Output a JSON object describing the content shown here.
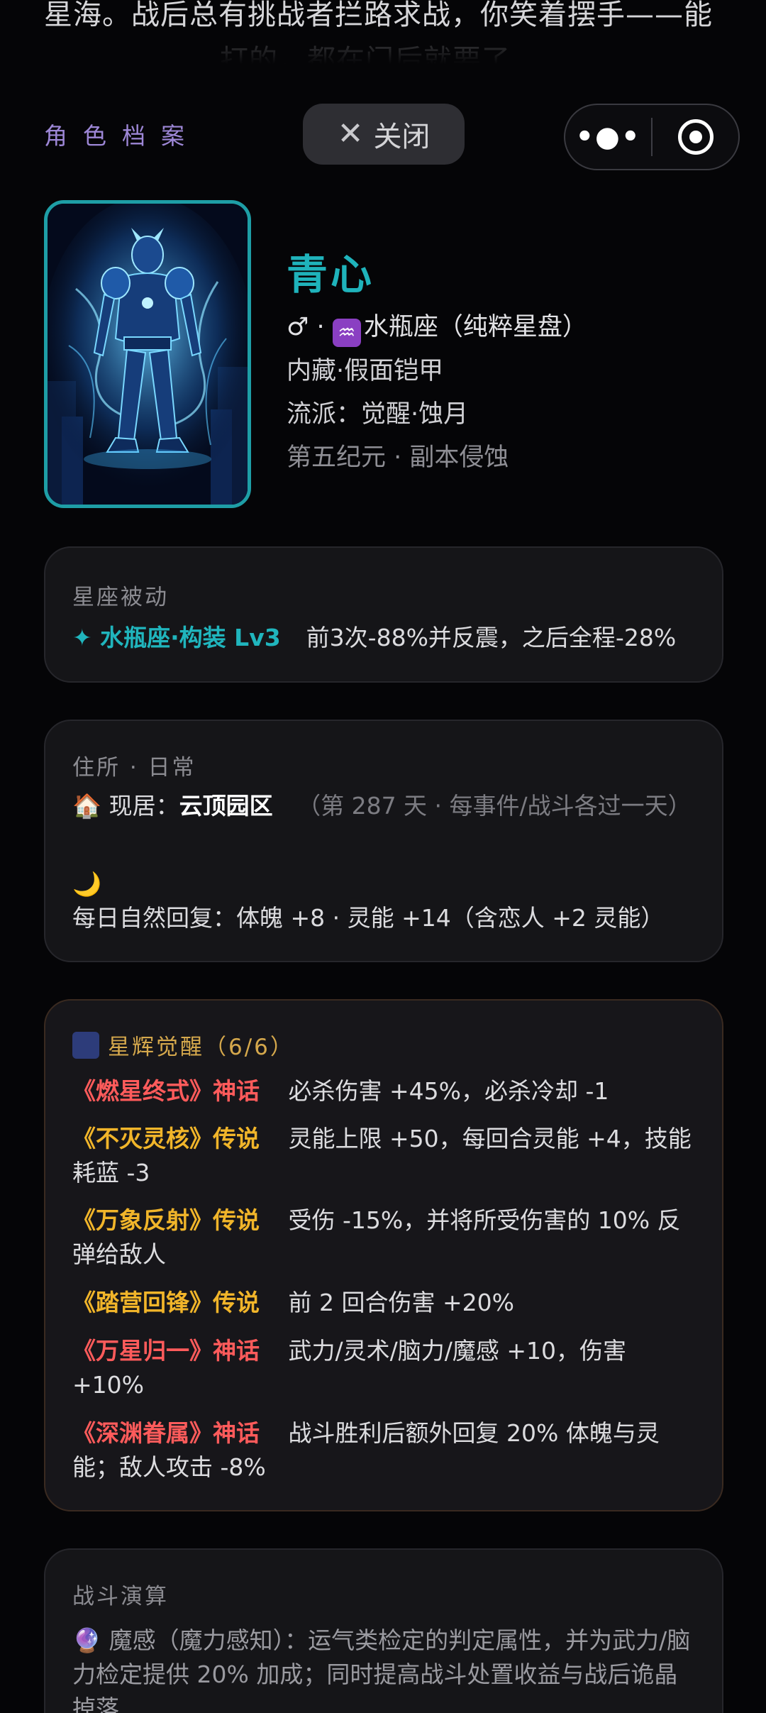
{
  "background_text": {
    "line1": "星海。战后总有挑战者拦路求战，你笑着摆手——能",
    "line2": "打的，都在门后就要了"
  },
  "header": {
    "section_label": "角色档案",
    "close_icon": "close-icon",
    "close_label": "关闭",
    "more_icon": "more-dots-icon",
    "target_icon": "target-icon"
  },
  "profile": {
    "name": "青心",
    "gender_symbol": "♂",
    "separator": "·",
    "zodiac_icon": "aquarius-icon",
    "zodiac_glyph": "♒",
    "zodiac": "水瓶座（纯粹星盘）",
    "line2": "内藏·假面铠甲",
    "line3": "流派：觉醒·蚀月",
    "line4": "第五纪元 · 副本侵蚀"
  },
  "passive": {
    "title": "星座被动",
    "skill_name": "✦ 水瓶座·构装 Lv3",
    "skill_desc": "前3次-88%并反震，之后全程-28%"
  },
  "residence": {
    "title": "住所 · 日常",
    "home_icon": "house-icon",
    "home_glyph": "🏠",
    "home_prefix": "现居：",
    "home_name": "云顶园区",
    "home_note": "（第 287 天 · 每事件/战斗各过一天）",
    "moon_icon": "moon-icon",
    "moon_glyph": "🌙",
    "regen_text": "每日自然回复：体魄 +8 · 灵能 +14（含恋人 +2 灵能）"
  },
  "awakening": {
    "icon": "shooting-star-icon",
    "title": "星辉觉醒（6/6）",
    "items": [
      {
        "name": "《燃星终式》神话",
        "tier": "myth",
        "desc": "必杀伤害 +45%，必杀冷却 -1"
      },
      {
        "name": "《不灭灵核》传说",
        "tier": "legend",
        "desc": "灵能上限 +50，每回合灵能 +4，技能耗蓝 -3"
      },
      {
        "name": "《万象反射》传说",
        "tier": "legend",
        "desc": "受伤 -15%，并将所受伤害的 10% 反弹给敌人"
      },
      {
        "name": "《踏营回锋》传说",
        "tier": "legend",
        "desc": "前 2 回合伤害 +20%"
      },
      {
        "name": "《万星归一》神话",
        "tier": "myth",
        "desc": "武力/灵术/脑力/魔感 +10，伤害 +10%"
      },
      {
        "name": "《深渊眷属》神话",
        "tier": "myth",
        "desc": "战斗胜利后额外回复 20% 体魄与灵能；敌人攻击 -8%"
      }
    ]
  },
  "combat": {
    "title": "战斗演算",
    "icon": "crystal-ball-icon",
    "glyph": "🔮",
    "text": "魔感（魔力感知）：运气类检定的判定属性，并为武力/脑力检定提供 20% 加成；同时提高战斗处置收益与战后诡晶掉落"
  },
  "colors": {
    "accent_teal": "#1fb3bb",
    "gold": "#f1b52a",
    "red": "#ff5b5b",
    "purple": "#9d87d6"
  }
}
